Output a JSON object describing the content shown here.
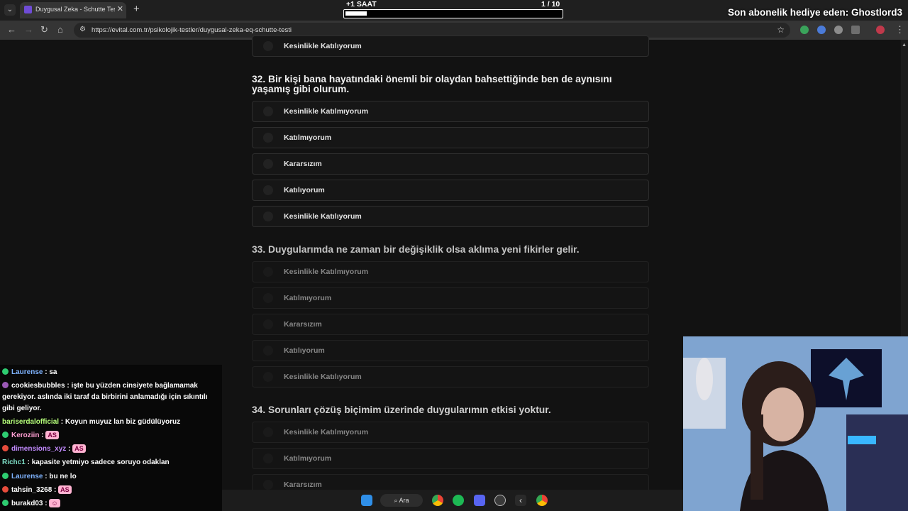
{
  "browser": {
    "tab_title": "Duygusal Zeka - Schutte Testi (EQ",
    "url": "https://evital.com.tr/psikolojik-testler/duygusal-zeka-eq-schutte-testi"
  },
  "overlay": {
    "timer_label": "+1 SAAT",
    "timer_count": "1   / 10",
    "timer_progress": 0.1,
    "sub_banner": "Son abonelik hediye eden: Ghostlord3"
  },
  "colors": {
    "background": "#121212",
    "option_border": "#2e2e2e",
    "question_text": "#f0f0f0"
  },
  "page": {
    "top_option_label": "Kesinlikle Katılıyorum",
    "questions": [
      {
        "text": "32. Bir kişi bana hayatındaki önemli bir olaydan bahsettiğinde ben de aynısını yaşamış gibi olurum.",
        "options": [
          "Kesinlikle Katılmıyorum",
          "Katılmıyorum",
          "Kararsızım",
          "Katılıyorum",
          "Kesinlikle Katılıyorum"
        ]
      },
      {
        "text": "33. Duygularımda ne zaman bir değişiklik olsa aklıma yeni fikirler gelir.",
        "options": [
          "Kesinlikle Katılmıyorum",
          "Katılmıyorum",
          "Kararsızım",
          "Katılıyorum",
          "Kesinlikle Katılıyorum"
        ]
      },
      {
        "text": "34. Sorunları çözüş biçimim üzerinde duygularımın etkisi yoktur.",
        "options": [
          "Kesinlikle Katılmıyorum",
          "Katılmıyorum",
          "Kararsızım"
        ]
      }
    ]
  },
  "chat": [
    {
      "user": "Laurense",
      "color": "#7fb3ff",
      "badge": "#2ecc71",
      "message": "sa"
    },
    {
      "user": "cookiesbubbles",
      "color": "#ffffff",
      "badge": "#9b59b6",
      "message": "işte bu yüzden cinsiyete bağlamamak gerekiyor. aslında iki taraf da birbirini anlamadığı için sıkıntılı gibi geliyor."
    },
    {
      "user": "bariserdalofficial",
      "color": "#b6ff7a",
      "badge": "",
      "message": "Koyun muyuz lan biz güdülüyoruz"
    },
    {
      "user": "Keroziin",
      "color": "#ff9fd3",
      "badge": "#2ecc71",
      "message": "",
      "emote": "AS"
    },
    {
      "user": "dimensions_xyz",
      "color": "#c38bff",
      "badge": "#e74c3c",
      "message": "",
      "emote": "AS"
    },
    {
      "user": "Richc1",
      "color": "#7fe0c8",
      "badge": "",
      "message": "kapasite yetmiyo sadece soruyo odaklan"
    },
    {
      "user": "Laurense",
      "color": "#7fb3ff",
      "badge": "#2ecc71",
      "message": "bu ne lo"
    },
    {
      "user": "tahsin_3268",
      "color": "#ffffff",
      "badge": "#e74c3c",
      "message": "",
      "emote": "AS"
    },
    {
      "user": "burakd03",
      "color": "#ffffff",
      "badge": "#2ecc71",
      "message": "",
      "emote": "☺"
    }
  ],
  "taskbar": {
    "search_label": "Ara",
    "icons": [
      "windows-start-icon",
      "chrome-icon",
      "spotify-icon",
      "discord-icon",
      "obs-icon",
      "app-icon",
      "chrome-icon"
    ]
  }
}
